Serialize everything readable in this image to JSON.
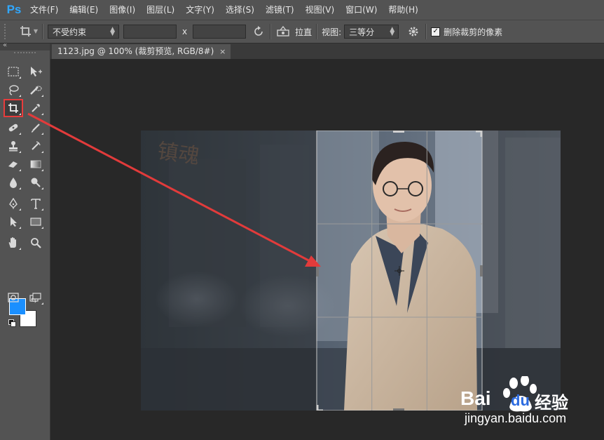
{
  "app": {
    "logo": "Ps",
    "logo_color": "#31a8ff"
  },
  "menu": [
    {
      "label": "文件(F)"
    },
    {
      "label": "编辑(E)"
    },
    {
      "label": "图像(I)"
    },
    {
      "label": "图层(L)"
    },
    {
      "label": "文字(Y)"
    },
    {
      "label": "选择(S)"
    },
    {
      "label": "滤镜(T)"
    },
    {
      "label": "视图(V)"
    },
    {
      "label": "窗口(W)"
    },
    {
      "label": "帮助(H)"
    }
  ],
  "options": {
    "ratio_value": "不受约束",
    "x_label": "x",
    "straighten_label": "拉直",
    "view_label": "视图:",
    "view_value": "三等分",
    "delete_pixels_label": "删除裁剪的像素",
    "delete_pixels_checked": true
  },
  "document": {
    "tab_title": "1123.jpg @ 100% (裁剪预览, RGB/8#)",
    "close_glyph": "×"
  },
  "colors": {
    "foreground": "#1a8fff",
    "background": "#ffffff",
    "highlight": "#e83c3c"
  },
  "watermark": {
    "brand": "Bai",
    "brand_du": "du",
    "brand_cn": "经验",
    "url": "jingyan.baidu.com",
    "image_text": "镇魂"
  }
}
